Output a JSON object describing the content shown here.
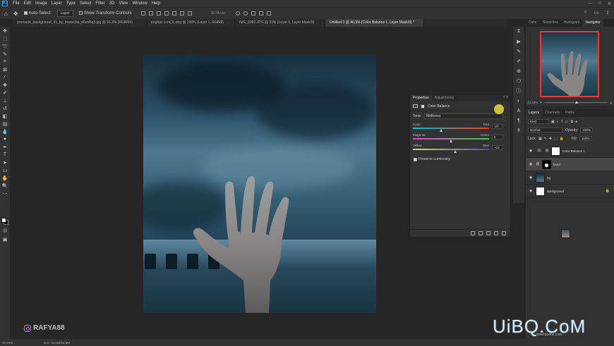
{
  "menubar": {
    "logo": "Ps",
    "items": [
      "File",
      "Edit",
      "Image",
      "Layer",
      "Type",
      "Select",
      "Filter",
      "3D",
      "View",
      "Window",
      "Help"
    ],
    "controls": [
      "—",
      "□",
      "✕"
    ]
  },
  "options": {
    "auto_select_label": "Auto-Select:",
    "auto_select_value": "Layer",
    "transform_controls_label": "Show Transform Controls",
    "mode_3d": "3D Mode:"
  },
  "tabs": [
    "premade_background_31_by_maiarcha_d6vw5q3.jpg @ 33.3% (RGB/8#)",
    "pngfuel.com(1).png @ 100% (Layer 1, RGB/8)",
    "IMG_5982.JPG @ 33% (Layer 0, Layer Mask/8)",
    "Untitled-1 @ 40,3% (Color Balance 1, Layer Mask/8) *"
  ],
  "properties": {
    "tab_properties": "Properties",
    "tab_adjustments": "Adjustments",
    "title": "Color Balance",
    "tone_label": "Tone:",
    "tone_value": "Midtones",
    "sliders": [
      {
        "left": "Cyan",
        "right": "Red",
        "value": "-27",
        "position": 0.37,
        "gradient": "linear-gradient(90deg,#00c8c8,#ff3030)"
      },
      {
        "left": "Magenta",
        "right": "Green",
        "value": "0",
        "position": 0.5,
        "gradient": "linear-gradient(90deg,#e040e0,#40d040)"
      },
      {
        "left": "Yellow",
        "right": "Blue",
        "value": "+12",
        "position": 0.56,
        "gradient": "linear-gradient(90deg,#f0e020,#3050ff)"
      }
    ],
    "preserve_luminosity": "Preserve Luminosity"
  },
  "right_panel": {
    "tabs": [
      "Color",
      "Swatches",
      "Histogram",
      "Navigator"
    ],
    "active_tab": "Navigator",
    "zoom": "40,34%"
  },
  "layers": {
    "tabs": [
      "Layers",
      "Channels",
      "Paths"
    ],
    "filter_kind": "Kind",
    "blend_mode": "Normal",
    "opacity_label": "Opacity:",
    "opacity_value": "100%",
    "lock_label": "Lock:",
    "fill_label": "Fill:",
    "fill_value": "100%",
    "items": [
      {
        "name": "Color Balance 1",
        "type": "adjustment",
        "selected": false
      },
      {
        "name": "hand",
        "type": "hand",
        "selected": true
      },
      {
        "name": "bg",
        "type": "sky",
        "selected": false
      },
      {
        "name": "Background",
        "type": "white",
        "selected": false,
        "italic": true,
        "locked": true
      }
    ]
  },
  "status": {
    "zoom": "40,34%",
    "doc": "Doc: 16,3M/52,6M"
  },
  "watermark": {
    "handle": "RAFYA88",
    "site_logo": "UiBQ.CoM",
    "site_url": "www.psahz.com"
  },
  "colors": {
    "accent": "#31a8ff",
    "navigator_frame": "#e43c3c",
    "panel_bg": "#323232",
    "workspace_bg": "#262626"
  }
}
